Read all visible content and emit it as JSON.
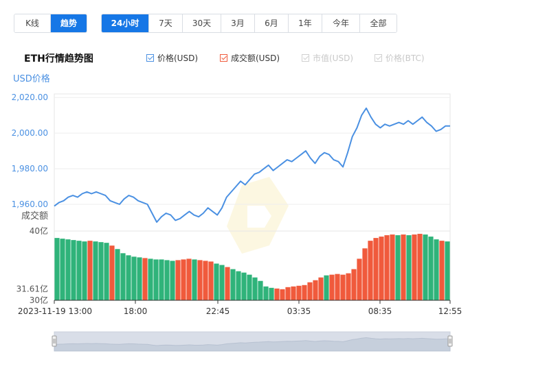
{
  "view_toggle": [
    {
      "label": "K线",
      "active": false
    },
    {
      "label": "趋势",
      "active": true
    }
  ],
  "range_tabs": [
    {
      "label": "24小时",
      "active": true
    },
    {
      "label": "7天",
      "active": false
    },
    {
      "label": "30天",
      "active": false
    },
    {
      "label": "3月",
      "active": false
    },
    {
      "label": "6月",
      "active": false
    },
    {
      "label": "1年",
      "active": false
    },
    {
      "label": "今年",
      "active": false
    },
    {
      "label": "全部",
      "active": false
    }
  ],
  "chart_title": "ETH行情趋势图",
  "legend": [
    {
      "label": "价格(USD)",
      "checked": true,
      "color": "#4a90e2",
      "enabled": true
    },
    {
      "label": "成交额(USD)",
      "checked": true,
      "color": "#f05a3c",
      "enabled": true
    },
    {
      "label": "市值(USD)",
      "checked": true,
      "color": "#c8c8c8",
      "enabled": false
    },
    {
      "label": "价格(BTC)",
      "checked": true,
      "color": "#c8c8c8",
      "enabled": false
    }
  ],
  "colors": {
    "price_line": "#4a90e2",
    "vol_up": "#f05a3c",
    "vol_down": "#2fb37a",
    "grid": "#eeeeee",
    "axis_text": "#4a90e2",
    "navigator": "#d9dee8"
  },
  "chart_data": [
    {
      "type": "line",
      "ylabel": "USD价格",
      "ylim": [
        1945,
        2022
      ],
      "yticks": [
        "2,020.00",
        "2,000.00",
        "1,980.00",
        "1,960.00"
      ],
      "ytick_values": [
        2020,
        2000,
        1980,
        1960
      ],
      "xticks": [
        "2023-11-19 13:00",
        "18:00",
        "22:45",
        "03:35",
        "08:35",
        "12:55"
      ],
      "series": [
        {
          "name": "价格(USD)",
          "values": [
            1959,
            1961,
            1962,
            1964,
            1965,
            1964,
            1966,
            1967,
            1966,
            1967,
            1966,
            1965,
            1962,
            1961,
            1960,
            1963,
            1965,
            1964,
            1962,
            1961,
            1960,
            1955,
            1950,
            1953,
            1955,
            1954,
            1951,
            1952,
            1954,
            1956,
            1954,
            1953,
            1955,
            1958,
            1956,
            1954,
            1958,
            1964,
            1967,
            1970,
            1973,
            1971,
            1974,
            1977,
            1978,
            1980,
            1982,
            1979,
            1981,
            1983,
            1985,
            1984,
            1986,
            1988,
            1990,
            1986,
            1983,
            1987,
            1989,
            1988,
            1985,
            1984,
            1981,
            1989,
            1998,
            2003,
            2010,
            2014,
            2009,
            2005,
            2003,
            2005,
            2004,
            2005,
            2006,
            2005,
            2007,
            2005,
            2007,
            2009,
            2006,
            2004,
            2001,
            2002,
            2004,
            2004
          ]
        }
      ]
    },
    {
      "type": "bar",
      "ylabel": "成交额",
      "ylim": [
        30,
        40
      ],
      "yticks": [
        "40亿",
        "31.61亿",
        "30亿"
      ],
      "ytick_values": [
        40,
        31.61,
        30
      ],
      "series": [
        {
          "name": "成交额(USD)",
          "values": [
            39.0,
            38.9,
            38.8,
            38.7,
            38.6,
            38.5,
            38.6,
            38.5,
            38.4,
            38.3,
            37.9,
            37.4,
            36.8,
            36.5,
            36.3,
            36.2,
            36.1,
            36.0,
            35.9,
            35.9,
            35.8,
            35.7,
            35.8,
            35.9,
            36.0,
            35.9,
            35.8,
            35.7,
            35.6,
            35.3,
            35.1,
            34.8,
            34.5,
            34.2,
            34.0,
            33.7,
            33.3,
            32.8,
            32.0,
            31.8,
            31.7,
            31.6,
            31.9,
            32.0,
            32.1,
            32.2,
            32.6,
            32.9,
            33.3,
            33.6,
            33.7,
            33.8,
            33.7,
            33.9,
            34.5,
            36.0,
            37.5,
            38.6,
            39.0,
            39.2,
            39.4,
            39.5,
            39.4,
            39.5,
            39.4,
            39.5,
            39.6,
            39.5,
            39.2,
            38.8,
            38.6,
            38.5
          ]
        },
        {
          "name": "direction",
          "values": [
            0,
            0,
            0,
            0,
            0,
            0,
            1,
            0,
            0,
            0,
            1,
            0,
            0,
            0,
            0,
            0,
            1,
            0,
            0,
            0,
            0,
            0,
            1,
            1,
            1,
            0,
            1,
            1,
            1,
            0,
            0,
            1,
            0,
            0,
            0,
            0,
            0,
            0,
            0,
            0,
            1,
            1,
            1,
            1,
            1,
            1,
            1,
            1,
            1,
            0,
            1,
            1,
            1,
            1,
            1,
            1,
            1,
            1,
            1,
            1,
            1,
            1,
            0,
            1,
            0,
            1,
            1,
            0,
            0,
            0,
            1,
            0
          ]
        }
      ]
    }
  ]
}
